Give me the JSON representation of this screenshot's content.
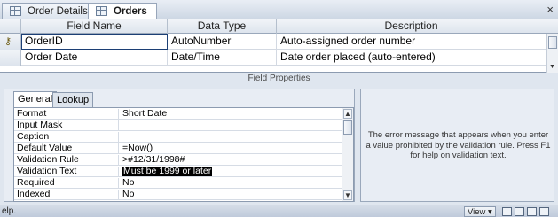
{
  "tabs": [
    {
      "label": "Order Details",
      "active": false
    },
    {
      "label": "Orders",
      "active": true
    }
  ],
  "close_glyph": "×",
  "grid": {
    "headers": {
      "field_name": "Field Name",
      "data_type": "Data Type",
      "description": "Description"
    },
    "rows": [
      {
        "field_name": "OrderID",
        "data_type": "AutoNumber",
        "description": "Auto-assigned order number",
        "primary_key": true
      },
      {
        "field_name": "Order Date",
        "data_type": "Date/Time",
        "description": "Date order placed (auto-entered)",
        "primary_key": false
      }
    ]
  },
  "field_properties_label": "Field Properties",
  "prop_tabs": {
    "general": "General",
    "lookup": "Lookup"
  },
  "properties": [
    {
      "label": "Format",
      "value": "Short Date"
    },
    {
      "label": "Input Mask",
      "value": ""
    },
    {
      "label": "Caption",
      "value": ""
    },
    {
      "label": "Default Value",
      "value": "=Now()"
    },
    {
      "label": "Validation Rule",
      "value": ">#12/31/1998#"
    },
    {
      "label": "Validation Text",
      "value": "Must be 1999 or later"
    },
    {
      "label": "Required",
      "value": "No"
    },
    {
      "label": "Indexed",
      "value": "No"
    }
  ],
  "help_text": "The error message that appears when you enter a value prohibited by the validation rule. Press F1 for help on validation text.",
  "status": {
    "text": "elp.",
    "view_label": "View ▾"
  }
}
